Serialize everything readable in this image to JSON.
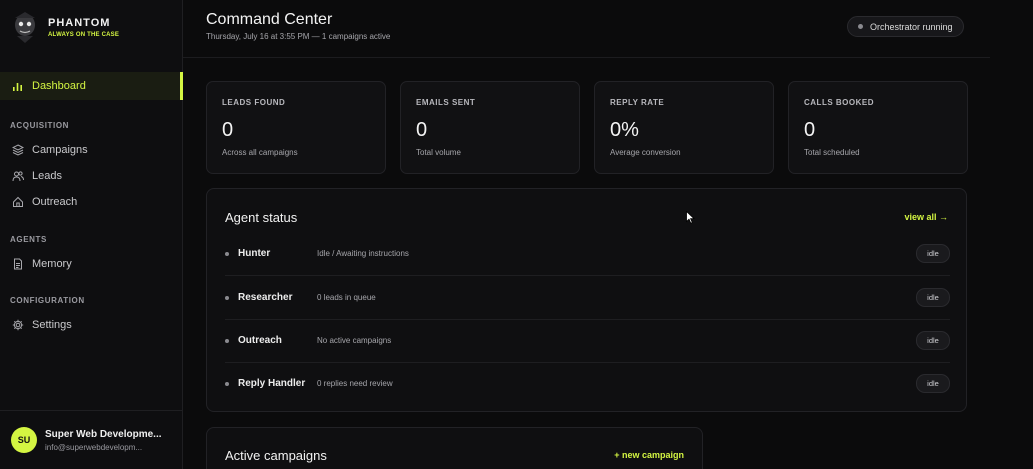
{
  "brand": {
    "name": "PHANTOM",
    "tagline": "ALWAYS ON THE CASE"
  },
  "sidebar": {
    "dashboard": {
      "label": "Dashboard",
      "icon": "bar-chart-icon"
    },
    "sections": [
      {
        "label": "ACQUISITION",
        "items": [
          {
            "label": "Campaigns",
            "icon": "layers-icon"
          },
          {
            "label": "Leads",
            "icon": "users-icon"
          },
          {
            "label": "Outreach",
            "icon": "home-icon"
          }
        ]
      },
      {
        "label": "AGENTS",
        "items": [
          {
            "label": "Memory",
            "icon": "document-icon"
          }
        ]
      },
      {
        "label": "CONFIGURATION",
        "items": [
          {
            "label": "Settings",
            "icon": "gear-icon"
          }
        ]
      }
    ]
  },
  "user": {
    "initials": "SU",
    "name": "Super Web Developme...",
    "email": "info@superwebdevelopm..."
  },
  "header": {
    "title": "Command Center",
    "subtitle": "Thursday, July 16 at 3:55 PM — 1 campaigns active",
    "status": "Orchestrator running"
  },
  "stats": [
    {
      "label": "LEADS FOUND",
      "value": "0",
      "desc": "Across all campaigns"
    },
    {
      "label": "EMAILS SENT",
      "value": "0",
      "desc": "Total volume"
    },
    {
      "label": "REPLY RATE",
      "value": "0%",
      "desc": "Average conversion"
    },
    {
      "label": "CALLS BOOKED",
      "value": "0",
      "desc": "Total scheduled"
    }
  ],
  "agents": {
    "title": "Agent status",
    "link": "view all →",
    "rows": [
      {
        "name": "Hunter",
        "desc": "Idle / Awaiting instructions",
        "status": "idle"
      },
      {
        "name": "Researcher",
        "desc": "0 leads in queue",
        "status": "idle"
      },
      {
        "name": "Outreach",
        "desc": "No active campaigns",
        "status": "idle"
      },
      {
        "name": "Reply Handler",
        "desc": "0 replies need review",
        "status": "idle"
      }
    ]
  },
  "campaigns": {
    "title": "Active campaigns",
    "link": "+ new campaign"
  },
  "colors": {
    "accent": "#d4f542",
    "background": "#0b0b0c",
    "panel": "#0f0f11"
  }
}
